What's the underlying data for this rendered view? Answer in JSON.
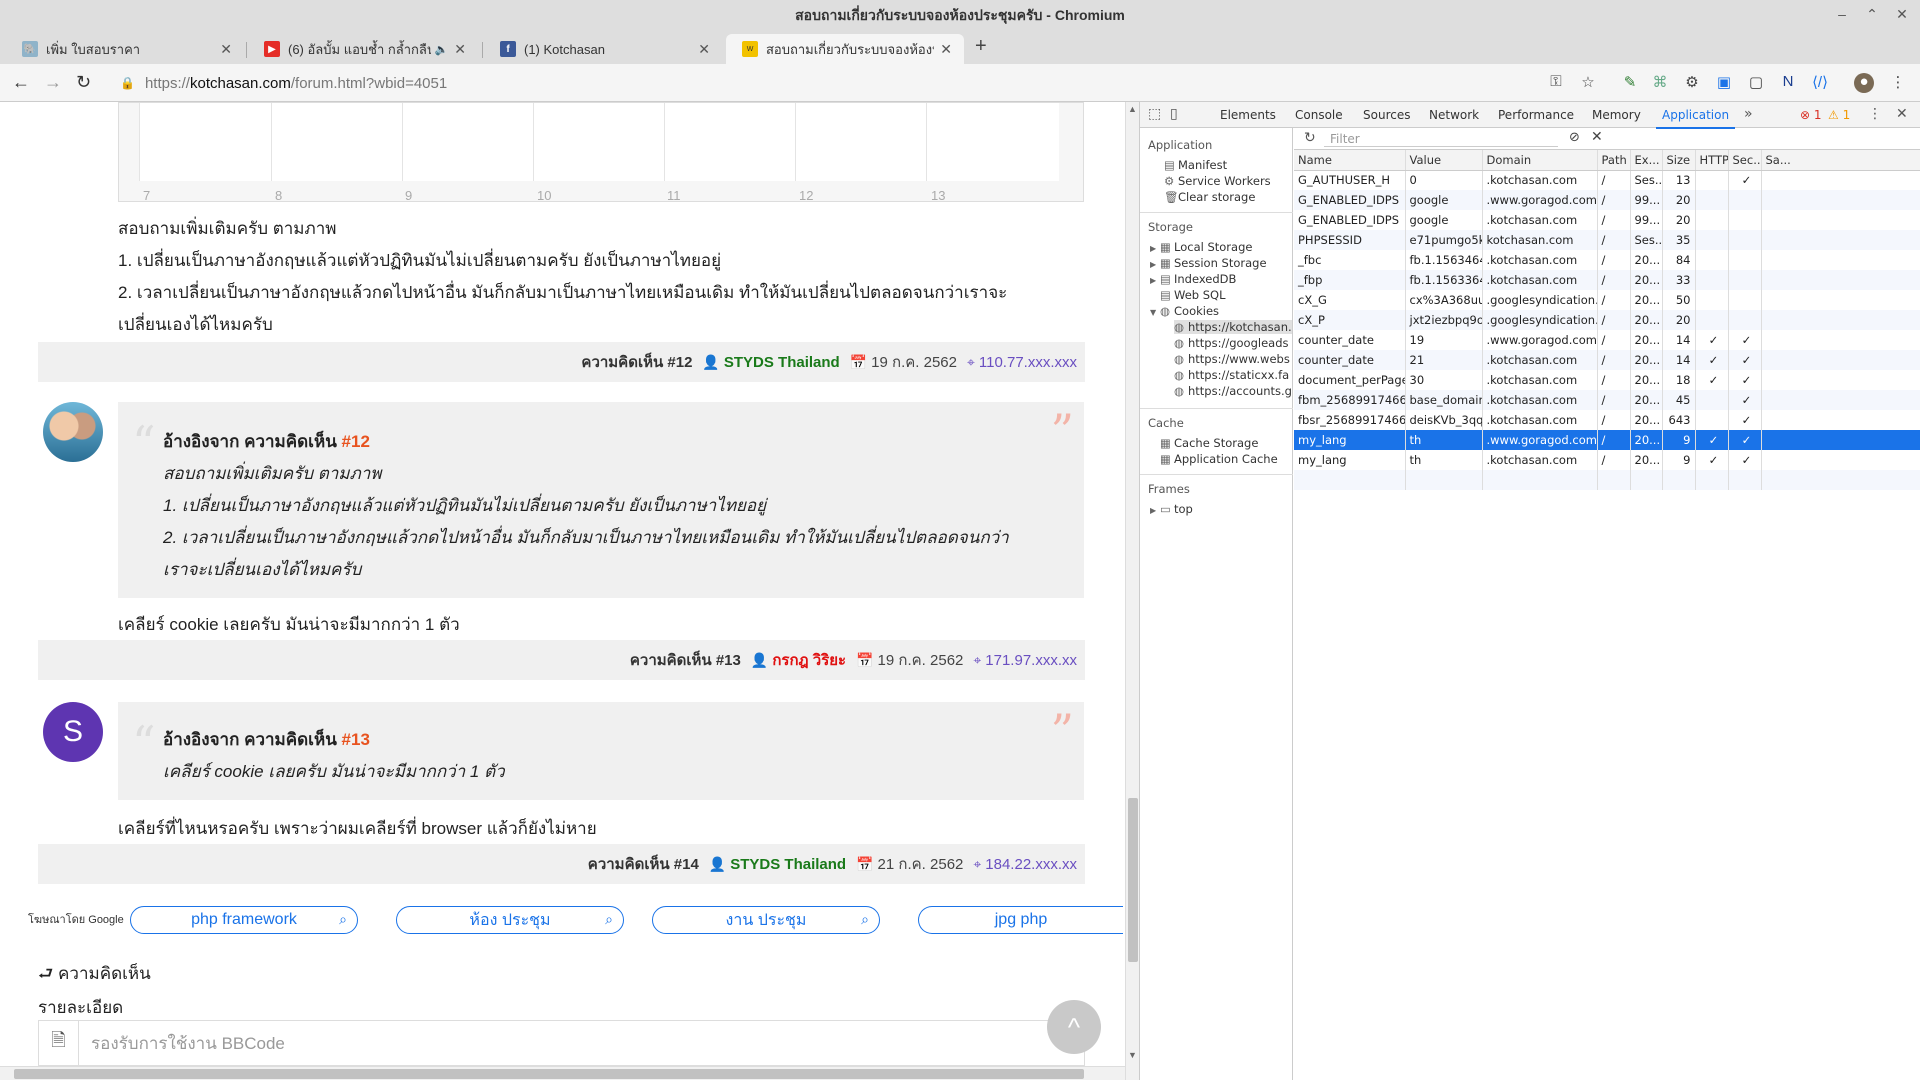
{
  "window": {
    "title": "สอบถามเกี่ยวกับระบบจองห้องประชุมครับ - Chromium"
  },
  "tabs": [
    {
      "label": "เพิ่ม ใบสอบราคา",
      "favicon": "elephant-icon"
    },
    {
      "label": "(6) อัลบั้ม แอบช้ำ กล้ำกลืน ขึ้",
      "favicon": "youtube-icon",
      "audio": "🔈"
    },
    {
      "label": "(1) Kotchasan",
      "favicon": "facebook-icon"
    },
    {
      "label": "สอบถามเกี่ยวกับระบบจองห้องประ",
      "favicon": "site-icon",
      "active": true
    }
  ],
  "toolbar": {
    "url_scheme": "https://",
    "url_host": "kotchasan.com",
    "url_path": "/forum.html?wbid=4051"
  },
  "calendar": {
    "days": [
      "7",
      "8",
      "9",
      "10",
      "11",
      "12",
      "13"
    ]
  },
  "posts": {
    "p11_text": [
      "สอบถามเพิ่มเติมครับ ตามภาพ",
      "1. เปลี่ยนเป็นภาษาอังกฤษแล้วแต่หัวปฏิทินมันไม่เปลี่ยนตามครับ ยังเป็นภาษาไทยอยู่",
      "2. เวลาเปลี่ยนเป็นภาษาอังกฤษแล้วกดไปหน้าอื่น มันก็กลับมาเป็นภาษาไทยเหมือนเดิม ทำให้มันเปลี่ยนไปตลอดจนกว่าเราจะ",
      "เปลี่ยนเองได้ไหมครับ"
    ],
    "f12": {
      "num": "ความคิดเห็น #12",
      "user": "STYDS Thailand",
      "date": "19 ก.ค. 2562",
      "ip": "110.77.xxx.xxx"
    },
    "q13": {
      "head": "อ้างอิงจาก ความคิดเห็น",
      "ref": "#12",
      "lines": [
        "สอบถามเพิ่มเติมครับ ตามภาพ",
        "1. เปลี่ยนเป็นภาษาอังกฤษแล้วแต่หัวปฏิทินมันไม่เปลี่ยนตามครับ ยังเป็นภาษาไทยอยู่",
        "2. เวลาเปลี่ยนเป็นภาษาอังกฤษแล้วกดไปหน้าอื่น มันก็กลับมาเป็นภาษาไทยเหมือนเดิม ทำให้มันเปลี่ยนไปตลอดจนกว่า",
        "เราจะเปลี่ยนเองได้ไหมครับ"
      ]
    },
    "p13_text": "เคลียร์ cookie เลยครับ มันน่าจะมีมากกว่า 1 ตัว",
    "f13": {
      "num": "ความคิดเห็น #13",
      "user": "กรกฎ วิริยะ",
      "date": "19 ก.ค. 2562",
      "ip": "171.97.xxx.xx"
    },
    "q14": {
      "avatar_letter": "S",
      "head": "อ้างอิงจาก ความคิดเห็น",
      "ref": "#13",
      "line": "เคลียร์ cookie เลยครับ มันน่าจะมีมากกว่า 1 ตัว"
    },
    "p14_text": "เคลียร์ที่ไหนหรอครับ เพราะว่าผมเคลียร์ที่ browser แล้วก็ยังไม่หาย",
    "f14": {
      "num": "ความคิดเห็น #14",
      "user": "STYDS Thailand",
      "date": "21 ก.ค. 2562",
      "ip": "184.22.xxx.xx"
    }
  },
  "ads": {
    "label": "โฆษณาโดย Google",
    "items": [
      "php framework",
      "ห้อง ประชุม",
      "งาน ประชุม",
      "jpg php"
    ]
  },
  "form": {
    "comment_title": "ความคิดเห็น",
    "detail_title": "รายละเอียด",
    "placeholder": "รองรับการใช้งาน BBCode"
  },
  "devtools": {
    "tabs": [
      "Elements",
      "Console",
      "Sources",
      "Network",
      "Performance",
      "Memory",
      "Application"
    ],
    "errors": "1",
    "warnings": "1",
    "sidebar": {
      "application_header": "Application",
      "application_items": [
        "Manifest",
        "Service Workers",
        "Clear storage"
      ],
      "storage_header": "Storage",
      "storage_items": [
        "Local Storage",
        "Session Storage",
        "IndexedDB",
        "Web SQL",
        "Cookies"
      ],
      "cookie_origins": [
        "https://kotchasan.com",
        "https://googleads",
        "https://www.webs",
        "https://staticxx.fa",
        "https://accounts.g"
      ],
      "cache_header": "Cache",
      "cache_items": [
        "Cache Storage",
        "Application Cache"
      ],
      "frames_header": "Frames",
      "frames_items": [
        "top"
      ]
    },
    "filter_placeholder": "Filter",
    "columns": [
      "Name",
      "Value",
      "Domain",
      "Path",
      "Ex...",
      "Size",
      "HTTP",
      "Sec...",
      "Sa..."
    ],
    "rows": [
      [
        "G_AUTHUSER_H",
        "0",
        ".kotchasan.com",
        "/",
        "Ses...",
        "13",
        "",
        "✓",
        ""
      ],
      [
        "G_ENABLED_IDPS",
        "google",
        ".www.goragod.com",
        "/",
        "99...",
        "20",
        "",
        "",
        ""
      ],
      [
        "G_ENABLED_IDPS",
        "google",
        ".kotchasan.com",
        "/",
        "99...",
        "20",
        "",
        "",
        ""
      ],
      [
        "PHPSESSID",
        "e71pumgo5k...",
        "kotchasan.com",
        "/",
        "Ses...",
        "35",
        "",
        "",
        ""
      ],
      [
        "_fbc",
        "fb.1.1563464...",
        ".kotchasan.com",
        "/",
        "20...",
        "84",
        "",
        "",
        ""
      ],
      [
        "_fbp",
        "fb.1.1563364...",
        ".kotchasan.com",
        "/",
        "20...",
        "33",
        "",
        "",
        ""
      ],
      [
        "cX_G",
        "cx%3A368uu...",
        ".googlesyndication.com",
        "/",
        "20...",
        "50",
        "",
        "",
        ""
      ],
      [
        "cX_P",
        "jxt2iezbpq9o...",
        ".googlesyndication.com",
        "/",
        "20...",
        "20",
        "",
        "",
        ""
      ],
      [
        "counter_date",
        "19",
        ".www.goragod.com",
        "/",
        "20...",
        "14",
        "✓",
        "✓",
        ""
      ],
      [
        "counter_date",
        "21",
        ".kotchasan.com",
        "/",
        "20...",
        "14",
        "✓",
        "✓",
        ""
      ],
      [
        "document_perPage",
        "30",
        ".kotchasan.com",
        "/",
        "20...",
        "18",
        "✓",
        "✓",
        ""
      ],
      [
        "fbm_25689917466...",
        "base_domain...",
        ".kotchasan.com",
        "/",
        "20...",
        "45",
        "",
        "✓",
        ""
      ],
      [
        "fbsr_25689917466...",
        "deisKVb_3qq...",
        ".kotchasan.com",
        "/",
        "20...",
        "643",
        "",
        "✓",
        ""
      ],
      [
        "my_lang",
        "th",
        ".www.goragod.com",
        "/",
        "20...",
        "9",
        "✓",
        "✓",
        ""
      ],
      [
        "my_lang",
        "th",
        ".kotchasan.com",
        "/",
        "20...",
        "9",
        "✓",
        "✓",
        ""
      ]
    ],
    "selected_row": 13
  },
  "colors": {
    "accent": "#1a73e8",
    "user_green": "#1a7a1a",
    "user_red": "#e01010",
    "ip_purple": "#6a4fc1",
    "quote_ref": "#e8531f"
  }
}
